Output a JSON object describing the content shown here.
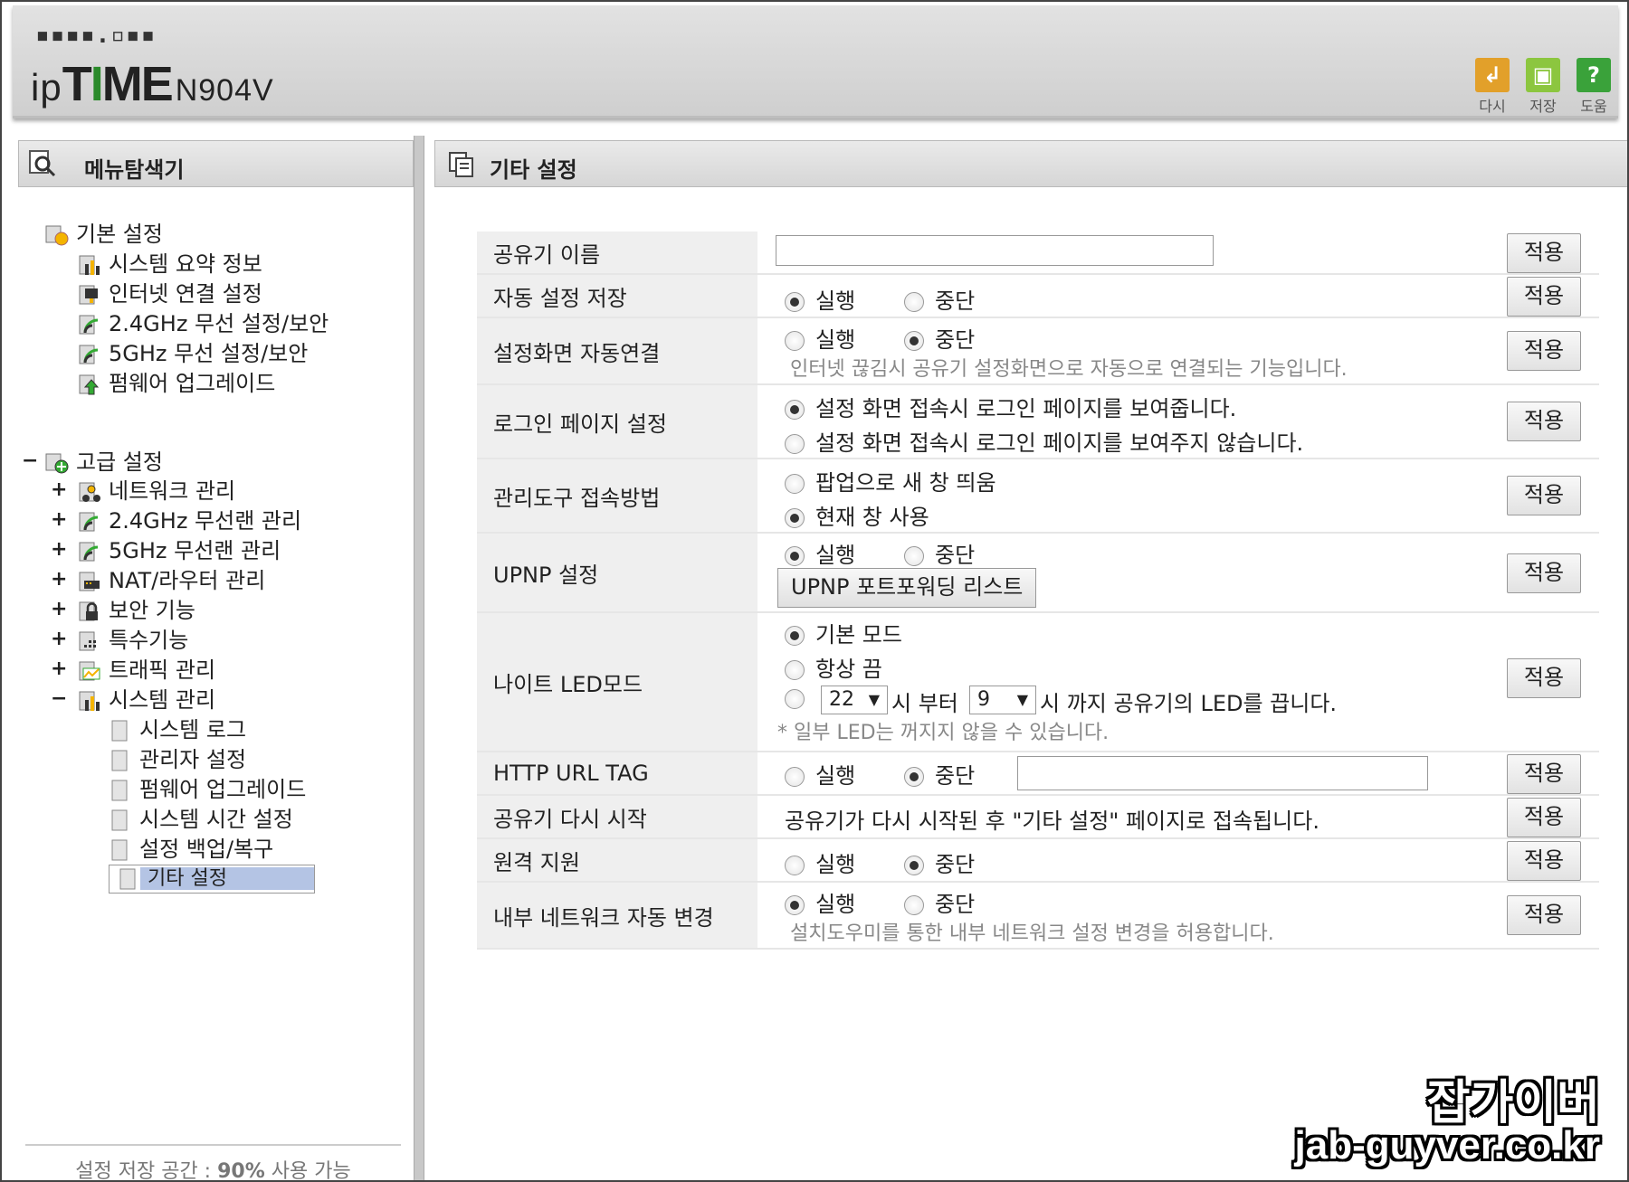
{
  "header": {
    "logo_mark": "▪▪▪▪.▫▪▪",
    "brand_ip": "ip",
    "brand_time_1": "T",
    "brand_time_2": "I",
    "brand_time_3": "ME",
    "model": "N904V",
    "buttons": [
      {
        "label": "다시",
        "icon": "undo-icon",
        "color": "#e2a02a",
        "glyph": "↲"
      },
      {
        "label": "저장",
        "icon": "save-icon",
        "color": "#8cc63f",
        "glyph": "▣"
      },
      {
        "label": "도움",
        "icon": "help-icon",
        "color": "#3aa23a",
        "glyph": "?"
      }
    ]
  },
  "sidebar": {
    "title": "메뉴탐색기",
    "basic": {
      "label": "기본 설정",
      "items": [
        "시스템 요약 정보",
        "인터넷 연결 설정",
        "2.4GHz 무선 설정/보안",
        "5GHz 무선 설정/보안",
        "펌웨어 업그레이드"
      ]
    },
    "advanced": {
      "label": "고급 설정",
      "items": [
        "네트워크 관리",
        "2.4GHz 무선랜 관리",
        "5GHz 무선랜 관리",
        "NAT/라우터 관리",
        "보안 기능",
        "특수기능",
        "트래픽 관리",
        "시스템 관리"
      ],
      "system_items": [
        "시스템 로그",
        "관리자 설정",
        "펌웨어 업그레이드",
        "시스템 시간 설정",
        "설정 백업/복구",
        "기타 설정"
      ]
    },
    "footer_prefix": "설정 저장 공간 : ",
    "footer_value": "90%",
    "footer_suffix": " 사용 가능"
  },
  "main": {
    "title": "기타 설정",
    "apply_label": "적용",
    "run": "실행",
    "stop": "중단",
    "rows": {
      "router_name": {
        "label": "공유기 이름",
        "value": ""
      },
      "auto_save": {
        "label": "자동 설정 저장",
        "selected": "실행"
      },
      "auto_connect": {
        "label": "설정화면 자동연결",
        "selected": "중단",
        "hint": "인터넷 끊김시 공유기 설정화면으로 자동으로 연결되는 기능입니다."
      },
      "login_page": {
        "label": "로그인 페이지 설정",
        "opt1": "설정 화면 접속시 로그인 페이지를 보여줍니다.",
        "opt2": "설정 화면 접속시 로그인 페이지를 보여주지 않습니다."
      },
      "admin_access": {
        "label": "관리도구 접속방법",
        "opt1": "팝업으로 새 창 띄움",
        "opt2": "현재 창 사용"
      },
      "upnp": {
        "label": "UPNP 설정",
        "selected": "실행",
        "button": "UPNP 포트포워딩 리스트"
      },
      "night_led": {
        "label": "나이트 LED모드",
        "opt1": "기본 모드",
        "opt2": "항상 끔",
        "from": "22",
        "to": "9",
        "from_text": "시 부터",
        "to_text": "시 까지 공유기의 LED를 끕니다.",
        "note": "* 일부 LED는 꺼지지 않을 수 있습니다."
      },
      "http_url_tag": {
        "label": "HTTP URL TAG",
        "selected": "중단",
        "value": ""
      },
      "restart": {
        "label": "공유기 다시 시작",
        "text": "공유기가 다시 시작된 후 \"기타 설정\" 페이지로 접속됩니다."
      },
      "remote": {
        "label": "원격 지원",
        "selected": "중단"
      },
      "internal_net": {
        "label": "내부 네트워크 자동 변경",
        "selected": "실행",
        "hint": "설치도우미를 통한 내부 네트워크 설정 변경을 허용합니다."
      }
    }
  },
  "watermark": {
    "line1": "잡가이버",
    "line2": "jab-guyver.co.kr"
  }
}
